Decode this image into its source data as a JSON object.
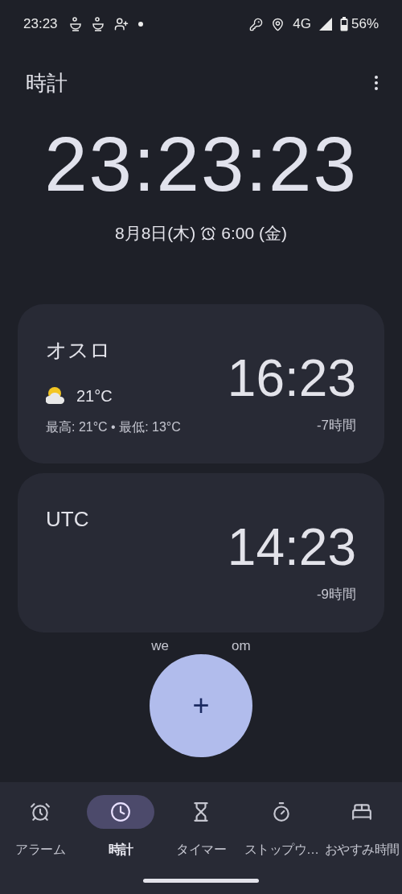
{
  "status_bar": {
    "time": "23:23",
    "network": "4G",
    "battery": "56%"
  },
  "app_bar": {
    "title": "時計"
  },
  "clock": {
    "time": "23:23:23",
    "date": "8月8日(木)",
    "alarm": "6:00 (金)"
  },
  "cities": [
    {
      "name": "オスロ",
      "time": "16:23",
      "offset": "-7時間",
      "weather": {
        "temp": "21°C",
        "range": "最高: 21°C • 最低: 13°C"
      }
    },
    {
      "name": "UTC",
      "time": "14:23",
      "offset": "-9時間"
    }
  ],
  "attribution": [
    "we",
    "om"
  ],
  "fab": {
    "label": "+"
  },
  "nav": [
    {
      "kind": "alarm",
      "label": "アラーム",
      "selected": false
    },
    {
      "kind": "clock",
      "label": "時計",
      "selected": true
    },
    {
      "kind": "timer",
      "label": "タイマー",
      "selected": false
    },
    {
      "kind": "stopwatch",
      "label": "ストップウ…",
      "selected": false
    },
    {
      "kind": "bedtime",
      "label": "おやすみ時間",
      "selected": false
    }
  ]
}
